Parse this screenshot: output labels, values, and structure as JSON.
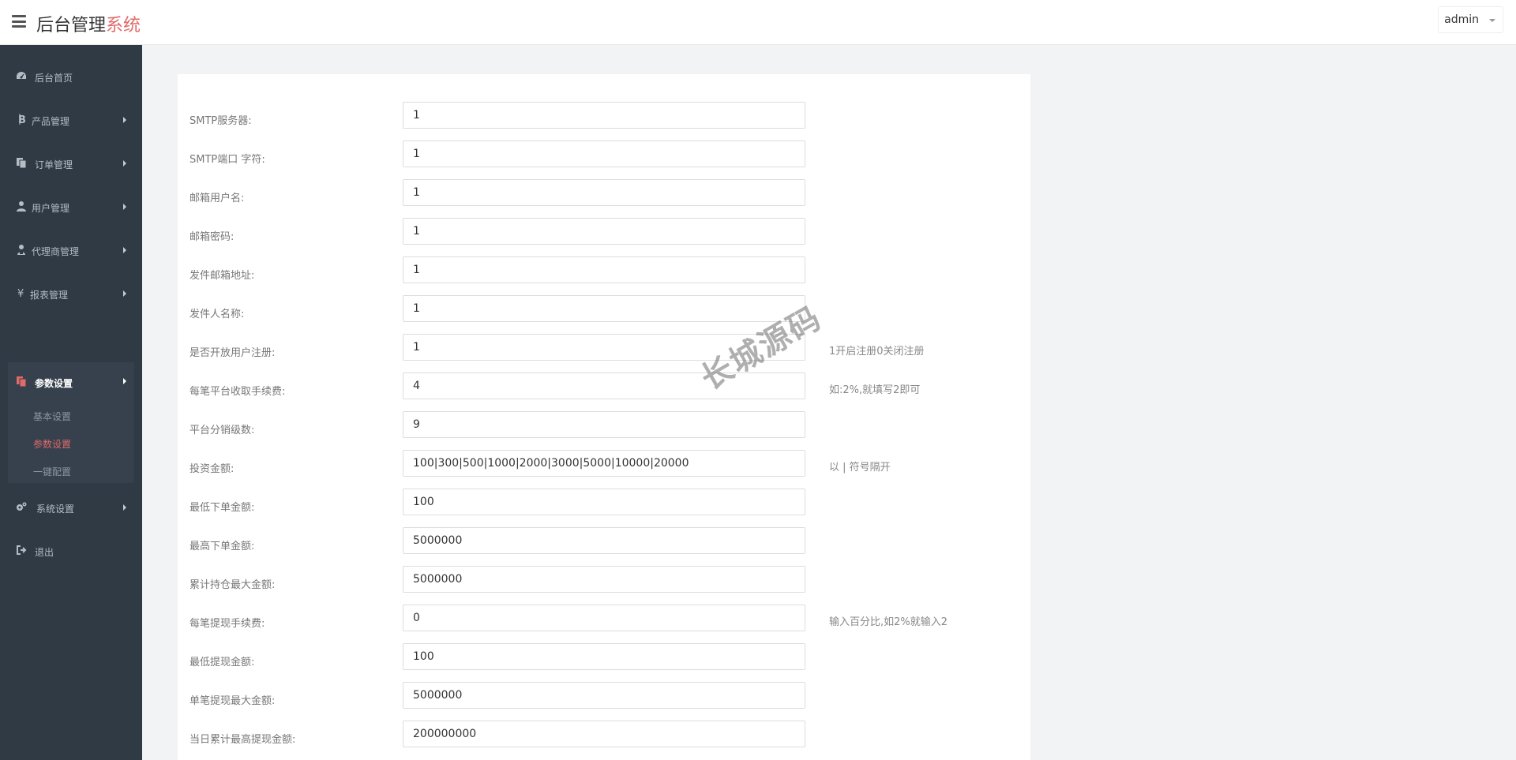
{
  "header": {
    "brand_main": "后台管理",
    "brand_accent": "系统",
    "user": "admin"
  },
  "sidebar": {
    "items": [
      {
        "label": "后台首页",
        "icon": "dashboard-icon"
      },
      {
        "label": "产品管理",
        "icon": "bitcoin-icon"
      },
      {
        "label": "订单管理",
        "icon": "copy-icon"
      },
      {
        "label": "用户管理",
        "icon": "user-icon"
      },
      {
        "label": "代理商管理",
        "icon": "users-icon"
      },
      {
        "label": "报表管理",
        "icon": "yen-icon"
      },
      {
        "label": "参数设置",
        "icon": "copy-icon"
      },
      {
        "label": "系统设置",
        "icon": "gears-icon"
      },
      {
        "label": "退出",
        "icon": "sign-out-icon"
      }
    ],
    "sub_items": [
      "基本设置",
      "参数设置",
      "一键配置"
    ]
  },
  "form": {
    "rows": [
      {
        "label": "SMTP服务器:",
        "value": "1",
        "hint": ""
      },
      {
        "label": "SMTP端口 字符:",
        "value": "1",
        "hint": ""
      },
      {
        "label": "邮箱用户名:",
        "value": "1",
        "hint": ""
      },
      {
        "label": "邮箱密码:",
        "value": "1",
        "hint": ""
      },
      {
        "label": "发件邮箱地址:",
        "value": "1",
        "hint": ""
      },
      {
        "label": "发件人名称:",
        "value": "1",
        "hint": ""
      },
      {
        "label": "是否开放用户注册:",
        "value": "1",
        "hint": "1开启注册0关闭注册"
      },
      {
        "label": "每笔平台收取手续费:",
        "value": "4",
        "hint": "如:2%,就填写2即可"
      },
      {
        "label": "平台分销级数:",
        "value": "9",
        "hint": ""
      },
      {
        "label": "投资金额:",
        "value": "100|300|500|1000|2000|3000|5000|10000|20000",
        "hint": "以 | 符号隔开"
      },
      {
        "label": "最低下单金额:",
        "value": "100",
        "hint": ""
      },
      {
        "label": "最高下单金额:",
        "value": "5000000",
        "hint": ""
      },
      {
        "label": "累计持仓最大金额:",
        "value": "5000000",
        "hint": ""
      },
      {
        "label": "每笔提现手续费:",
        "value": "0",
        "hint": "输入百分比,如2%就输入2"
      },
      {
        "label": "最低提现金额:",
        "value": "100",
        "hint": ""
      },
      {
        "label": "单笔提现最大金额:",
        "value": "5000000",
        "hint": ""
      },
      {
        "label": "当日累计最高提现金额:",
        "value": "200000000",
        "hint": ""
      }
    ]
  },
  "watermark": "长城源码"
}
